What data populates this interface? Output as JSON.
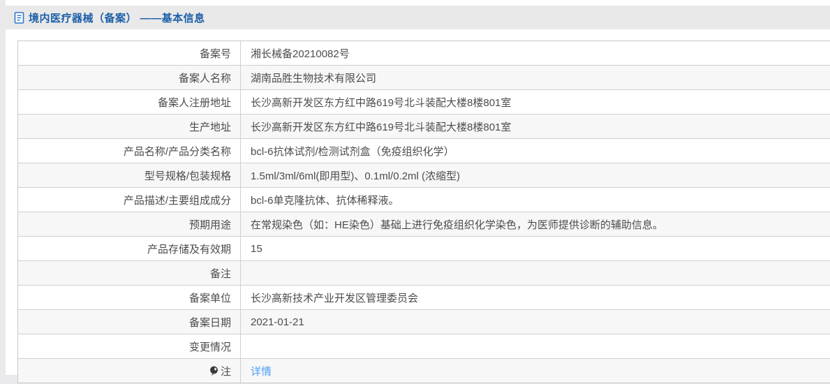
{
  "header": {
    "title": "境内医疗器械（备案） ——基本信息",
    "icon": "document-icon",
    "title_color": "#1c5fa8"
  },
  "table": {
    "rows": [
      {
        "label": "备案号",
        "value": "湘长械备20210082号"
      },
      {
        "label": "备案人名称",
        "value": "湖南品胜生物技术有限公司"
      },
      {
        "label": "备案人注册地址",
        "value": "长沙高新开发区东方红中路619号北斗装配大楼8楼801室"
      },
      {
        "label": "生产地址",
        "value": "长沙高新开发区东方红中路619号北斗装配大楼8楼801室"
      },
      {
        "label": "产品名称/产品分类名称",
        "value": "bcl-6抗体试剂/检测试剂盒（免疫组织化学）"
      },
      {
        "label": "型号规格/包装规格",
        "value": "1.5ml/3ml/6ml(即用型)、0.1ml/0.2ml (浓缩型)"
      },
      {
        "label": "产品描述/主要组成成分",
        "value": "bcl-6单克隆抗体、抗体稀释液。"
      },
      {
        "label": "预期用途",
        "value": "在常规染色（如：HE染色）基础上进行免疫组织化学染色，为医师提供诊断的辅助信息。"
      },
      {
        "label": "产品存储及有效期",
        "value": "15"
      },
      {
        "label": "备注",
        "value": ""
      },
      {
        "label": "备案单位",
        "value": "长沙高新技术产业开发区管理委员会"
      },
      {
        "label": "备案日期",
        "value": "2021-01-21"
      },
      {
        "label": "变更情况",
        "value": ""
      },
      {
        "label": "注",
        "value": "详情",
        "label_icon": "bulb-icon",
        "value_is_link": true
      }
    ]
  },
  "colors": {
    "header_bar_bg": "#e9e9e9",
    "title_blue": "#1c5fa8",
    "link_blue": "#4a9ff5",
    "row_alt_bg": "#f7f7f7",
    "border": "#cfcfcf",
    "text": "#4c4c4c"
  }
}
